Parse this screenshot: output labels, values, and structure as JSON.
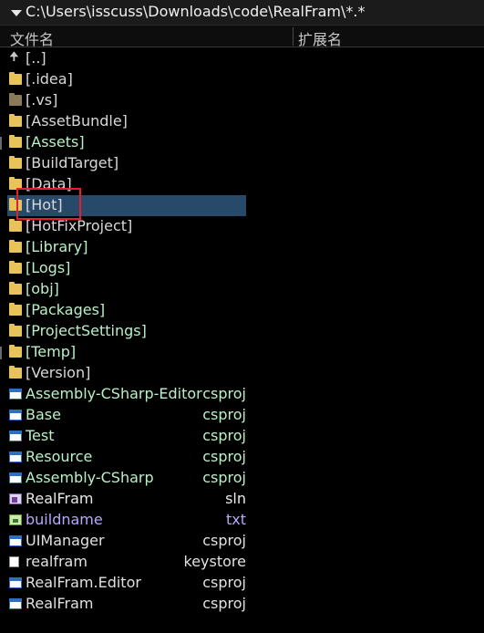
{
  "path_bar": {
    "path": "C:\\Users\\isscuss\\Downloads\\code\\RealFram\\*.*"
  },
  "columns": {
    "name": "文件名",
    "ext": "扩展名"
  },
  "colors": {
    "selection": "#274a6a",
    "highlight_box": "#e0202a",
    "folder": "#e8c25a"
  },
  "files": [
    {
      "name": "[..]",
      "ext": "",
      "icon": "up-arrow-icon",
      "kind": "up",
      "color": "c-dir"
    },
    {
      "name": "[.idea]",
      "ext": "",
      "icon": "folder-icon",
      "kind": "folder",
      "color": "c-dir"
    },
    {
      "name": "[.vs]",
      "ext": "",
      "icon": "hidden-folder-icon",
      "kind": "folder vs",
      "color": "c-dir"
    },
    {
      "name": "[AssetBundle]",
      "ext": "",
      "icon": "folder-icon",
      "kind": "folder",
      "color": "c-dir"
    },
    {
      "name": "[Assets]",
      "ext": "",
      "icon": "folder-icon",
      "kind": "folder",
      "color": "c-proj"
    },
    {
      "name": "[BuildTarget]",
      "ext": "",
      "icon": "folder-icon",
      "kind": "folder",
      "color": "c-dir"
    },
    {
      "name": "[Data]",
      "ext": "",
      "icon": "folder-icon",
      "kind": "folder",
      "color": "c-dir"
    },
    {
      "name": "[Hot]",
      "ext": "",
      "icon": "folder-icon",
      "kind": "folder",
      "color": "c-dir",
      "selected": true
    },
    {
      "name": "[HotFixProject]",
      "ext": "",
      "icon": "folder-icon",
      "kind": "folder",
      "color": "c-dir"
    },
    {
      "name": "[Library]",
      "ext": "",
      "icon": "folder-icon",
      "kind": "folder",
      "color": "c-proj"
    },
    {
      "name": "[Logs]",
      "ext": "",
      "icon": "folder-icon",
      "kind": "folder",
      "color": "c-proj"
    },
    {
      "name": "[obj]",
      "ext": "",
      "icon": "folder-icon",
      "kind": "folder",
      "color": "c-proj"
    },
    {
      "name": "[Packages]",
      "ext": "",
      "icon": "folder-icon",
      "kind": "folder",
      "color": "c-proj"
    },
    {
      "name": "[ProjectSettings]",
      "ext": "",
      "icon": "folder-icon",
      "kind": "folder",
      "color": "c-proj"
    },
    {
      "name": "[Temp]",
      "ext": "",
      "icon": "folder-icon",
      "kind": "folder",
      "color": "c-proj"
    },
    {
      "name": "[Version]",
      "ext": "",
      "icon": "folder-icon",
      "kind": "folder",
      "color": "c-dir"
    },
    {
      "name": "Assembly-CSharp-Editor",
      "ext": "csproj",
      "icon": "csproj-file-icon",
      "kind": "proj",
      "color": "c-proj"
    },
    {
      "name": "Base",
      "ext": "csproj",
      "icon": "csproj-file-icon",
      "kind": "proj",
      "color": "c-proj"
    },
    {
      "name": "Test",
      "ext": "csproj",
      "icon": "csproj-file-icon",
      "kind": "proj",
      "color": "c-proj"
    },
    {
      "name": "Resource",
      "ext": "csproj",
      "icon": "csproj-file-icon",
      "kind": "proj",
      "color": "c-proj"
    },
    {
      "name": "Assembly-CSharp",
      "ext": "csproj",
      "icon": "csproj-file-icon",
      "kind": "proj",
      "color": "c-proj"
    },
    {
      "name": "RealFram",
      "ext": "sln",
      "icon": "sln-file-icon",
      "kind": "sln",
      "color": "c-sln"
    },
    {
      "name": "buildname",
      "ext": "txt",
      "icon": "txt-file-icon",
      "kind": "txt",
      "color": "c-txt"
    },
    {
      "name": "UIManager",
      "ext": "csproj",
      "icon": "csproj-file-icon",
      "kind": "proj",
      "color": "c-plain"
    },
    {
      "name": "realfram",
      "ext": "keystore",
      "icon": "document-file-icon",
      "kind": "doc",
      "color": "c-plain"
    },
    {
      "name": "RealFram.Editor",
      "ext": "csproj",
      "icon": "csproj-file-icon",
      "kind": "proj",
      "color": "c-plain"
    },
    {
      "name": "RealFram",
      "ext": "csproj",
      "icon": "csproj-file-icon",
      "kind": "proj",
      "color": "c-plain"
    }
  ]
}
